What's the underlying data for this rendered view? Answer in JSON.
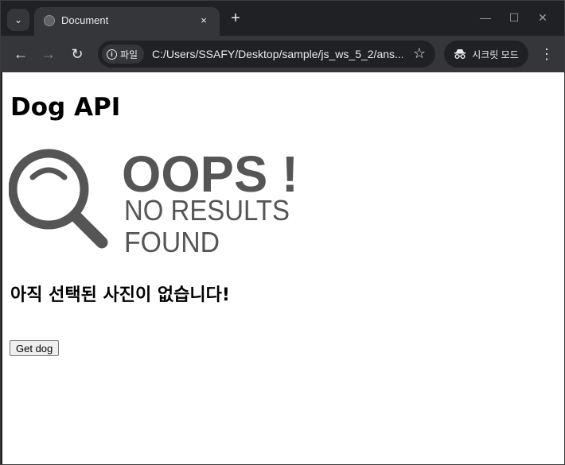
{
  "browser": {
    "tab": {
      "title": "Document",
      "close_icon": "×"
    },
    "new_tab_icon": "+",
    "window_controls": {
      "minimize": "—",
      "maximize": "☐",
      "close": "✕"
    },
    "address": {
      "chip_label": "파일",
      "url": "C:/Users/SSAFY/Desktop/sample/js_ws_5_2/ans..."
    },
    "incognito_label": "시크릿 모드",
    "icons": [
      "tab-search-icon",
      "globe-icon",
      "back-arrow-icon",
      "forward-arrow-icon",
      "reload-icon",
      "info-icon",
      "star-icon",
      "incognito-icon",
      "kebab-menu-icon"
    ]
  },
  "page": {
    "heading": "Dog API",
    "image": {
      "line1": "OOPS !",
      "line2": "NO RESULTS",
      "line3": "FOUND",
      "color": "#555555"
    },
    "message": "아직 선택된 사진이 없습니다!",
    "button_label": "Get dog"
  }
}
